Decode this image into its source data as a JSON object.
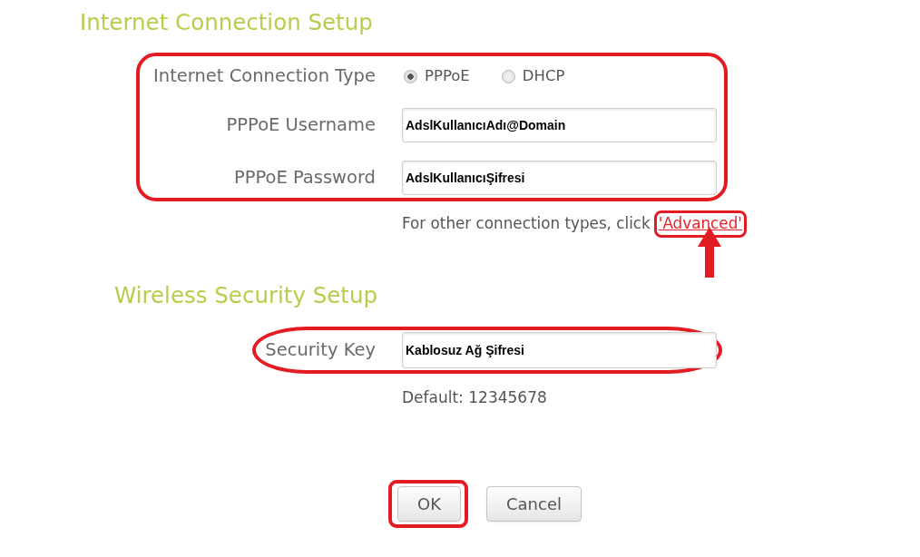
{
  "sections": [
    {
      "title": "Internet Connection Setup",
      "highlighted": true,
      "fields": [
        {
          "kind": "radio",
          "label": "Internet Connection Type",
          "options": [
            {
              "label": "PPPoE",
              "selected": true
            },
            {
              "label": "DHCP",
              "selected": false
            }
          ]
        },
        {
          "kind": "text",
          "label": "PPPoE Username",
          "value": "AdslKullanıcıAdı@Domain"
        },
        {
          "kind": "text",
          "label": "PPPoE Password",
          "value": "AdslKullanıcıŞifresi"
        }
      ],
      "hint": {
        "text": "For other connection types, click",
        "link": "'Advanced'",
        "highlighted": true,
        "arrow": true
      }
    },
    {
      "title": "Wireless Security Setup",
      "highlighted": true,
      "fields": [
        {
          "kind": "text",
          "label": "Security Key",
          "value": "Kablosuz Ağ Şifresi"
        }
      ],
      "hint": {
        "text": "Default: 12345678"
      }
    }
  ],
  "buttons": [
    {
      "label": "OK",
      "highlighted": true
    },
    {
      "label": "Cancel",
      "highlighted": false
    }
  ]
}
